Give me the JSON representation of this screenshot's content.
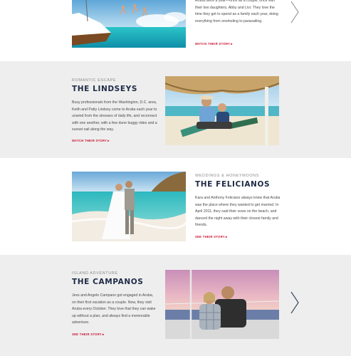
{
  "stories": [
    {
      "eyebrow": "",
      "title": "",
      "body": "Aruba twice a year—once as a couple, once with their two daughters, Abby and Livi. They love the time they get to spend as a family each year, doing everything from snorkeling to parasailing.",
      "link_label": "WATCH THEIR STORY",
      "link_arrow": "▸"
    },
    {
      "eyebrow": "ROMANTIC ESCAPE",
      "title": "THE LINDSEYS",
      "body": "Busy professionals from the Washington, D.C. area, Keith and Patty Lindsey come to Aruba each year to unwind from the stresses of daily life, and reconnect with one another, with a few dune buggy rides and a sunset sail along the way.",
      "link_label": "WATCH THEIR STORY",
      "link_arrow": "▸"
    },
    {
      "eyebrow": "WEDDINGS & HONEYMOONS",
      "title": "THE FELICIANOS",
      "body": "Kara and Anthony Feliciano always knew that Aruba was the place where they wanted to get married. In April 2011, they said their vows on the beach, and danced the night away with their closest family and friends.",
      "link_label": "SEE THEIR STORY",
      "link_arrow": "▸"
    },
    {
      "eyebrow": "ISLAND ADVENTURE",
      "title": "THE CAMPANOS",
      "body": "Jess and Angelo Campano got engaged in Aruba, on their first vacation as a couple. Now, they visit Aruba every October. They love that they can wake up without a plan, and always find a memorable adventure.",
      "link_label": "SEE THEIR STORY",
      "link_arrow": "▸"
    }
  ],
  "colors": {
    "title": "#1e2a45",
    "link": "#c8102e",
    "section_gray": "#eeeeee"
  },
  "icons": {
    "next": "chevron-right-icon"
  }
}
